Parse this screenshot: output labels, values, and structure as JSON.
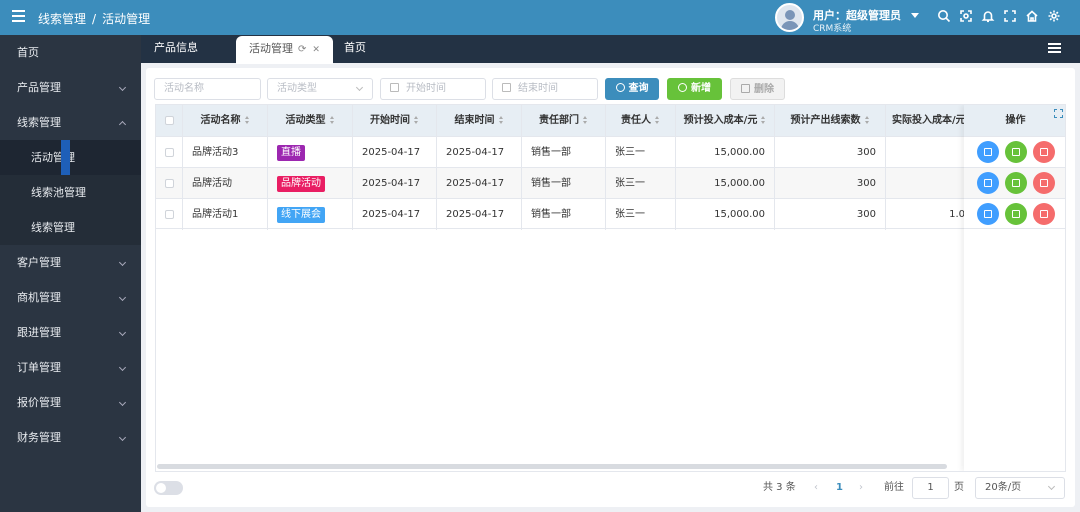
{
  "header": {
    "breadcrumb": [
      "线索管理",
      "活动管理"
    ],
    "user_name": "用户：超级管理员",
    "user_system": "CRM系统",
    "icons": [
      "search-icon",
      "screenshot-icon",
      "bell-icon",
      "fullscreen-icon",
      "home-icon",
      "settings-icon"
    ]
  },
  "sidebar": {
    "items": [
      {
        "label": "首页"
      },
      {
        "label": "产品管理"
      },
      {
        "label": "线索管理",
        "expanded": true,
        "children": [
          {
            "label": "活动管理",
            "active": true
          },
          {
            "label": "线索池管理"
          },
          {
            "label": "线索管理"
          }
        ]
      },
      {
        "label": "客户管理"
      },
      {
        "label": "商机管理"
      },
      {
        "label": "跟进管理"
      },
      {
        "label": "订单管理"
      },
      {
        "label": "报价管理"
      },
      {
        "label": "财务管理"
      }
    ]
  },
  "tabs": {
    "product": "产品信息",
    "activity": "活动管理",
    "home": "首页"
  },
  "filters": {
    "name_placeholder": "活动名称",
    "type_placeholder": "活动类型",
    "start_placeholder": "开始时间",
    "end_placeholder": "结束时间"
  },
  "buttons": {
    "query": "查询",
    "add": "新增",
    "delete": "删除"
  },
  "table": {
    "columns": [
      "活动名称",
      "活动类型",
      "开始时间",
      "结束时间",
      "责任部门",
      "责任人",
      "预计投入成本/元",
      "预计产出线索数",
      "实际投入成本/元"
    ],
    "action_header": "操作",
    "rows": [
      {
        "name": "品牌活动3",
        "type": "直播",
        "type_color": "#9c27b0",
        "start": "2025-04-17",
        "end": "2025-04-17",
        "dept": "销售一部",
        "owner": "张三一",
        "est_cost": "15,000.00",
        "est_leads": "300",
        "actual_cost": ""
      },
      {
        "name": "品牌活动",
        "type": "品牌活动",
        "type_color": "#e91e63",
        "start": "2025-04-17",
        "end": "2025-04-17",
        "dept": "销售一部",
        "owner": "张三一",
        "est_cost": "15,000.00",
        "est_leads": "300",
        "actual_cost": ""
      },
      {
        "name": "品牌活动1",
        "type": "线下展会",
        "type_color": "#42a5f5",
        "start": "2025-04-17",
        "end": "2025-04-17",
        "dept": "销售一部",
        "owner": "张三一",
        "est_cost": "15,000.00",
        "est_leads": "300",
        "actual_cost": "1.0"
      }
    ]
  },
  "pagination": {
    "total": "共 3 条",
    "current": "1",
    "goto_label": "前往",
    "goto_value": "1",
    "page_unit": "页",
    "page_size": "20条/页"
  }
}
